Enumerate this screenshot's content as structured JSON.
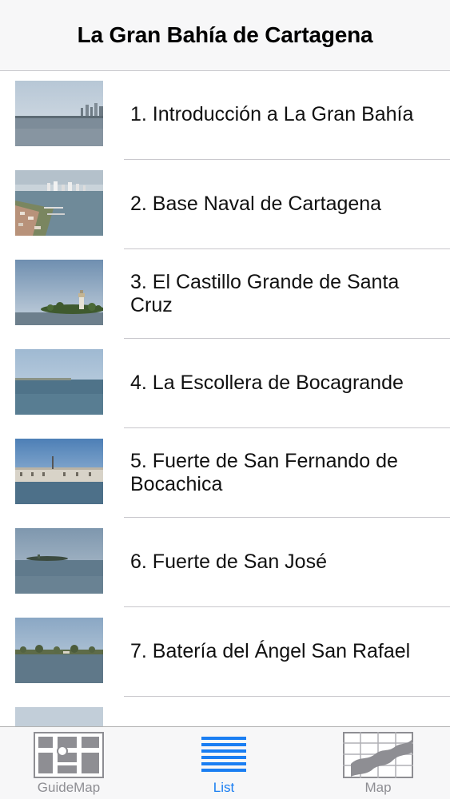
{
  "navbar": {
    "title": "La Gran Bahía de Cartagena"
  },
  "items": [
    {
      "label": "1. Introducción a La Gran Bahía",
      "thumb": "bay-skyline-photo"
    },
    {
      "label": "2. Base Naval de Cartagena",
      "thumb": "naval-base-aerial-photo"
    },
    {
      "label": "3. El Castillo Grande de Santa Cruz",
      "thumb": "lighthouse-island-photo"
    },
    {
      "label": "4. La Escollera de Bocagrande",
      "thumb": "breakwater-sea-photo"
    },
    {
      "label": "5. Fuerte de San Fernando de Bocachica",
      "thumb": "fort-waterfront-photo"
    },
    {
      "label": "6. Fuerte de San José",
      "thumb": "fort-island-photo"
    },
    {
      "label": "7. Batería del Ángel San Rafael",
      "thumb": "coast-trees-photo"
    },
    {
      "label": "",
      "thumb": "sky-photo"
    }
  ],
  "tabs": [
    {
      "label": "GuideMap",
      "icon": "guidemap-icon",
      "active": false
    },
    {
      "label": "List",
      "icon": "list-icon",
      "active": true
    },
    {
      "label": "Map",
      "icon": "map-icon",
      "active": false
    }
  ],
  "colors": {
    "accent": "#1a7ef2",
    "inactive": "#8e8e93",
    "separator": "#c8c7cc"
  }
}
